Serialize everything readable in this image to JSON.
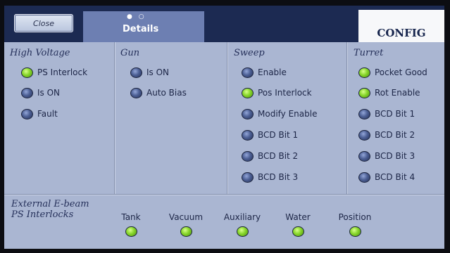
{
  "header": {
    "close_label": "Close",
    "details_label": "Details",
    "details_dots": "● ○",
    "config_label": "CONFIG"
  },
  "sections": {
    "high_voltage": {
      "title": "High Voltage",
      "items": [
        {
          "label": "PS Interlock",
          "state": "on"
        },
        {
          "label": "Is ON",
          "state": "off"
        },
        {
          "label": "Fault",
          "state": "off"
        }
      ]
    },
    "gun": {
      "title": "Gun",
      "items": [
        {
          "label": "Is ON",
          "state": "off"
        },
        {
          "label": "Auto Bias",
          "state": "off"
        }
      ]
    },
    "sweep": {
      "title": "Sweep",
      "items": [
        {
          "label": "Enable",
          "state": "off"
        },
        {
          "label": "Pos Interlock",
          "state": "on"
        },
        {
          "label": "Modify Enable",
          "state": "off"
        },
        {
          "label": "BCD Bit 1",
          "state": "off"
        },
        {
          "label": "BCD Bit 2",
          "state": "off"
        },
        {
          "label": "BCD Bit 3",
          "state": "off"
        }
      ]
    },
    "turret": {
      "title": "Turret",
      "items": [
        {
          "label": "Pocket Good",
          "state": "on"
        },
        {
          "label": "Rot Enable",
          "state": "on"
        },
        {
          "label": "BCD Bit 1",
          "state": "off"
        },
        {
          "label": "BCD Bit 2",
          "state": "off"
        },
        {
          "label": "BCD Bit 3",
          "state": "off"
        },
        {
          "label": "BCD Bit 4",
          "state": "off"
        }
      ]
    }
  },
  "external": {
    "title_line1": "External E-beam",
    "title_line2": "PS Interlocks",
    "items": [
      {
        "label": "Tank",
        "state": "on"
      },
      {
        "label": "Vacuum",
        "state": "on"
      },
      {
        "label": "Auxiliary",
        "state": "on"
      },
      {
        "label": "Water",
        "state": "on"
      },
      {
        "label": "Position",
        "state": "on"
      }
    ]
  },
  "colors": {
    "led_on": "#86d52a",
    "led_off": "#4c5f94",
    "panel_bg": "#aab6d2",
    "header_bg": "#1c2a52",
    "tab_active": "#6d7fb2"
  }
}
